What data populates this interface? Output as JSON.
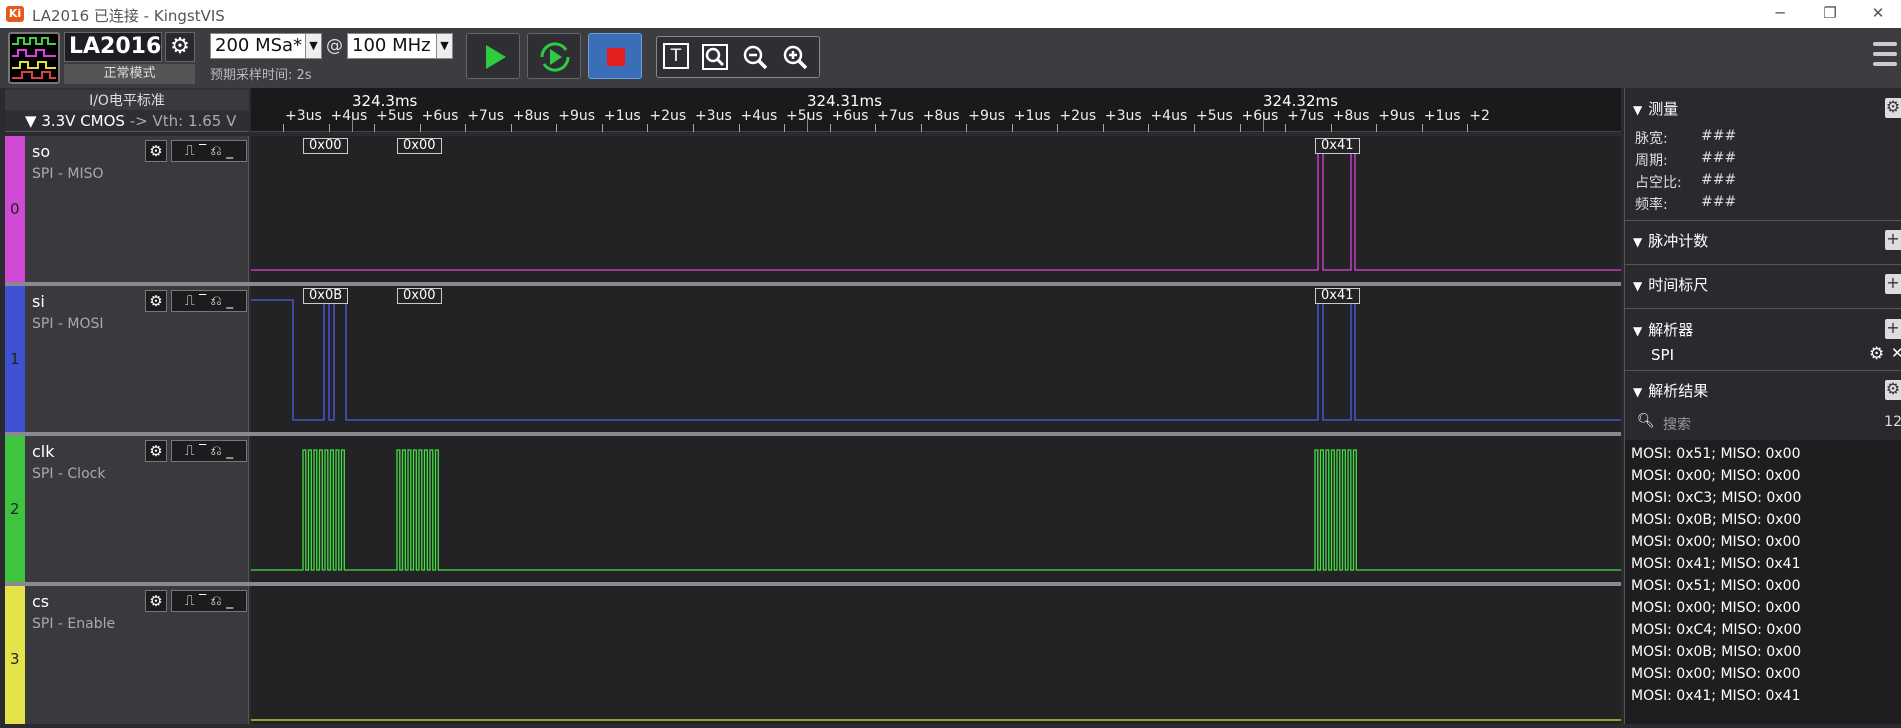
{
  "window": {
    "title": "LA2016 已连接 - KingstVIS",
    "logo": "Ki",
    "min": "─",
    "max": "❐",
    "close": "✕"
  },
  "toolbar": {
    "device_name": "LA2016",
    "device_mode": "正常模式",
    "sample_rate": "200 MSa*",
    "at": "@",
    "sample_freq": "100 MHz",
    "pre_sample": "预期采样时间: 2s"
  },
  "io": {
    "label": "I/O电平标准",
    "standard": "3.3V CMOS",
    "vth": "-> Vth: 1.65 V"
  },
  "ruler": {
    "major": [
      "324.3ms",
      "324.31ms",
      "324.32ms"
    ],
    "ticks": [
      "+3us",
      "+4us",
      "+5us",
      "+6us",
      "+7us",
      "+8us",
      "+9us",
      "+1us",
      "+2us",
      "+3us",
      "+4us",
      "+5us",
      "+6us",
      "+7us",
      "+8us",
      "+9us",
      "+1us",
      "+2us",
      "+3us",
      "+4us",
      "+5us",
      "+6us",
      "+7us",
      "+8us",
      "+9us",
      "+1us",
      "+2"
    ]
  },
  "channels": [
    {
      "index": "0",
      "name": "so",
      "sub": "SPI - MISO",
      "color": "#e040e0",
      "strip": "#d04ad6",
      "labels": [
        "0x00",
        "0x00",
        "0x41"
      ]
    },
    {
      "index": "1",
      "name": "si",
      "sub": "SPI - MOSI",
      "color": "#4a5fe8",
      "strip": "#3f52d4",
      "labels": [
        "0x0B",
        "0x00",
        "0x41"
      ]
    },
    {
      "index": "2",
      "name": "clk",
      "sub": "SPI - Clock",
      "color": "#44dd44",
      "strip": "#3fc43f",
      "labels": []
    },
    {
      "index": "3",
      "name": "cs",
      "sub": "SPI - Enable",
      "color": "#e5e53a",
      "strip": "#e4e44a",
      "labels": []
    }
  ],
  "panel": {
    "measure": "测量",
    "measure_rows": [
      {
        "k": "脉宽:",
        "v": "###"
      },
      {
        "k": "周期:",
        "v": "###"
      },
      {
        "k": "占空比:",
        "v": "###"
      },
      {
        "k": "频率:",
        "v": "###"
      }
    ],
    "pulse_count": "脉冲计数",
    "time_ruler": "时间标尺",
    "analyzer": "解析器",
    "analyzer_item": "SPI",
    "results": "解析结果",
    "search_placeholder": "搜索",
    "result_count": "12",
    "result_rows": [
      "MOSI: 0x51;  MISO: 0x00",
      "MOSI: 0x00;  MISO: 0x00",
      "MOSI: 0xC3;  MISO: 0x00",
      "MOSI: 0x0B;  MISO: 0x00",
      "MOSI: 0x00;  MISO: 0x00",
      "MOSI: 0x41;  MISO: 0x41",
      "MOSI: 0x51;  MISO: 0x00",
      "MOSI: 0x00;  MISO: 0x00",
      "MOSI: 0xC4;  MISO: 0x00",
      "MOSI: 0x0B;  MISO: 0x00",
      "MOSI: 0x00;  MISO: 0x00",
      "MOSI: 0x41;  MISO: 0x41"
    ]
  }
}
